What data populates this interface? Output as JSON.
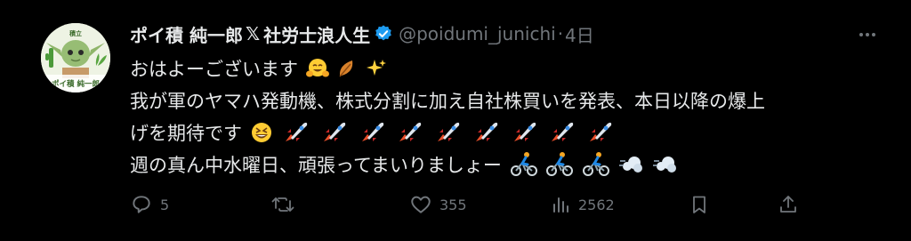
{
  "author": {
    "display_name": "ポイ積 純一郎",
    "name_suffix": "社労士浪人生",
    "handle": "@poidumi_junichi",
    "separator": "·",
    "time": "4日",
    "avatar_caption": "ポイ積 純一郎",
    "avatar_badge": "積立"
  },
  "tweet": {
    "lines": [
      "おはよーございます",
      "我が軍のヤマハ発動機、株式分割に加え自社株買いを発表、本日以降の爆上",
      "げを期待です",
      "週の真ん中水曜日、頑張ってまいりましょー"
    ]
  },
  "actions": {
    "replies": "5",
    "retweets": "",
    "likes": "355",
    "views": "2562"
  },
  "colors": {
    "background": "#000000",
    "text": "#e7e9ea",
    "muted": "#71767b",
    "verified": "#1d9bf0"
  }
}
